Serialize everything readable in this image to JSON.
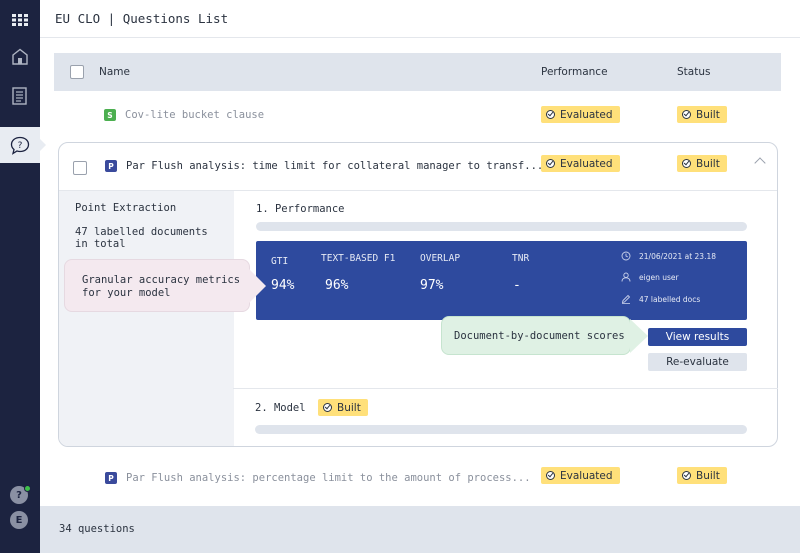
{
  "header": {
    "title": "EU CLO | Questions List"
  },
  "table": {
    "columns": {
      "name": "Name",
      "performance": "Performance",
      "status": "Status"
    }
  },
  "rows": [
    {
      "tag": "S",
      "name": "Cov-lite bucket clause",
      "performance": "Evaluated",
      "status": "Built"
    },
    {
      "tag": "P",
      "name": "Par Flush analysis: time limit for collateral manager to transf...",
      "performance": "Evaluated",
      "status": "Built",
      "expanded": true
    },
    {
      "tag": "P",
      "name": "Par Flush analysis: percentage limit to the amount of process...",
      "performance": "Evaluated",
      "status": "Built"
    }
  ],
  "detail": {
    "type": "Point Extraction",
    "labelled_docs_line1": "47 labelled documents",
    "labelled_docs_line2": "in total",
    "performance_title": "1. Performance",
    "metrics": [
      {
        "label": "GTI",
        "value": "94%"
      },
      {
        "label": "TEXT-BASED F1",
        "value": "96%"
      },
      {
        "label": "OVERLAP",
        "value": "97%"
      },
      {
        "label": "TNR",
        "value": "-"
      }
    ],
    "meta": {
      "date": "21/06/2021 at 23.18",
      "user": "eigen user",
      "docs": "47 labelled docs"
    },
    "view_results_label": "View results",
    "reevaluate_label": "Re-evaluate",
    "model_title": "2. Model",
    "model_status": "Built"
  },
  "callouts": {
    "accuracy_line1": "Granular accuracy metrics",
    "accuracy_line2": "for your model",
    "scores": "Document-by-document scores"
  },
  "sidebar": {
    "avatar_letter": "E",
    "help_glyph": "?"
  },
  "footer": {
    "count": "34 questions"
  },
  "colors": {
    "sidebar": "#1c2340",
    "accent_blue": "#2e4a9e",
    "badge_yellow": "#ffe07a",
    "tag_green": "#4caf50",
    "tag_blue": "#3a4a9c"
  }
}
